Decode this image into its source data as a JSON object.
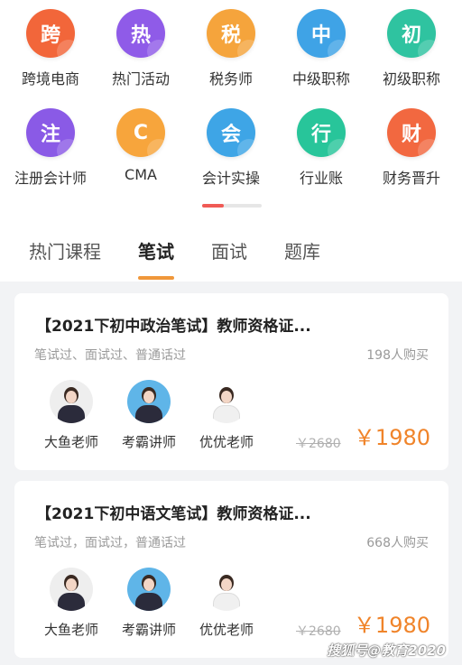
{
  "categories": {
    "row1": [
      {
        "glyph": "跨",
        "label": "跨境电商",
        "color": "#f2663a",
        "icon": "cross-border-icon"
      },
      {
        "glyph": "热",
        "label": "热门活动",
        "color": "#8f5be8",
        "icon": "hot-icon"
      },
      {
        "glyph": "税",
        "label": "税务师",
        "color": "#f5a43c",
        "icon": "tax-icon"
      },
      {
        "glyph": "中",
        "label": "中级职称",
        "color": "#3fa3e6",
        "icon": "intermediate-icon"
      },
      {
        "glyph": "初",
        "label": "初级职称",
        "color": "#2fc3a0",
        "icon": "junior-icon"
      }
    ],
    "row2": [
      {
        "glyph": "注",
        "label": "注册会计师",
        "color": "#8a5ae6",
        "icon": "cpa-icon"
      },
      {
        "glyph": "C",
        "label": "CMA",
        "color": "#f7a53c",
        "icon": "cma-icon"
      },
      {
        "glyph": "会",
        "label": "会计实操",
        "color": "#3ea5e6",
        "icon": "accounting-icon"
      },
      {
        "glyph": "行",
        "label": "行业账",
        "color": "#28c59a",
        "icon": "industry-icon"
      },
      {
        "glyph": "财",
        "label": "财务晋升",
        "color": "#f26840",
        "icon": "finance-icon"
      }
    ]
  },
  "tabs": [
    "热门课程",
    "笔试",
    "面试",
    "题库"
  ],
  "active_tab": 1,
  "cards": [
    {
      "title": "【2021下初中政治笔试】教师资格证...",
      "tags": "笔试过、面试过、普通话过",
      "buyers": "198人购买",
      "teachers": [
        "大鱼老师",
        "考霸讲师",
        "优优老师"
      ],
      "price_old": "￥2680",
      "price_new": "￥1980"
    },
    {
      "title": "【2021下初中语文笔试】教师资格证...",
      "tags": "笔试过，面试过，普通话过",
      "buyers": "668人购买",
      "teachers": [
        "大鱼老师",
        "考霸讲师",
        "优优老师"
      ],
      "price_old": "￥2680",
      "price_new": "￥1980"
    }
  ],
  "watermark": "搜狐号@教育2020"
}
